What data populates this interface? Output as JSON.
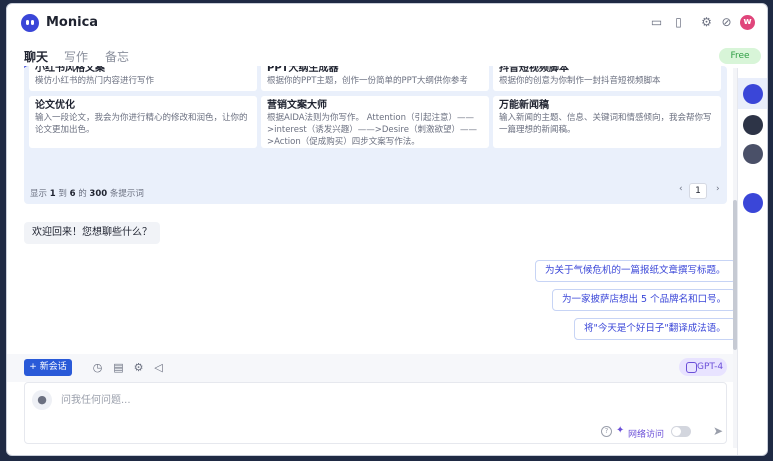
{
  "app": {
    "title": "Monica",
    "avatar_letter": "w"
  },
  "header_icons": [
    "monitor-icon",
    "phone-icon",
    "gear-icon",
    "pin-icon"
  ],
  "tabs": [
    {
      "label": "聊天",
      "active": true
    },
    {
      "label": "写作",
      "active": false
    },
    {
      "label": "备忘",
      "active": false
    }
  ],
  "plan_badge": "Free",
  "prompts": {
    "cards": [
      {
        "title": "小红书风格文案",
        "desc": "模仿小红书的热门内容进行写作"
      },
      {
        "title": "PPT大纲生成器",
        "desc": "根据你的PPT主题，创作一份简单的PPT大纲供你参考"
      },
      {
        "title": "抖音短视频脚本",
        "desc": "根据你的创意为你制作一封抖音短视频脚本"
      },
      {
        "title": "论文优化",
        "desc": "输入一段论文，我会为你进行精心的修改和润色，让你的论文更加出色。"
      },
      {
        "title": "营销文案大师",
        "desc": "根据AIDA法则为你写作。 Attention（引起注意）——>interest（诱发兴趣）——>Desire（刺激欲望）——>Action（促成购买）四步文案写作法。"
      },
      {
        "title": "万能新闻稿",
        "desc": "输入新闻的主题、信息、关键词和情感倾向，我会帮你写一篇理想的新闻稿。"
      }
    ],
    "pager": {
      "prefix": "显示",
      "from": "1",
      "mid": "到",
      "to": "6",
      "of": "的",
      "total": "300",
      "suffix": "条提示词",
      "page": "1",
      "prev": "‹",
      "next": "›"
    }
  },
  "chat": {
    "welcome": "欢迎回来！您想聊些什么？",
    "suggestions": [
      "为关于气候危机的一篇报纸文章撰写标题。",
      "为一家披萨店想出 5 个品牌名和口号。",
      "将\"今天是个好日子\"翻译成法语。"
    ]
  },
  "toolbar": {
    "new_chat": "+ 新会话",
    "model": "GPT-4"
  },
  "input": {
    "placeholder": "问我任何问题...",
    "web_access_label": "网络访问",
    "web_access_enabled": false
  },
  "colors": {
    "accent": "#3a46d8",
    "primary_button": "#2a5ad8",
    "prompt_panel": "#eaf0fb"
  }
}
